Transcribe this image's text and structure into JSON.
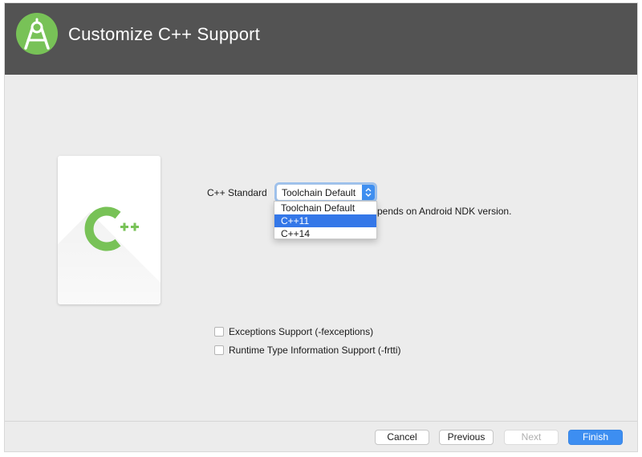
{
  "window": {
    "title": "Customize C++ Support"
  },
  "icons": {
    "logo": "android-studio-icon",
    "cpp": "cpp-logo-icon",
    "stepper": "updown-chevron-icon"
  },
  "colors": {
    "header_bg": "#535353",
    "logo_green": "#78c257",
    "selection_blue": "#3477e8",
    "primary_button": "#3d8ef1"
  },
  "form": {
    "cpp_standard_label": "C++ Standard",
    "cpp_standard_value": "Toolchain Default",
    "dropdown_options": [
      "Toolchain Default",
      "C++11",
      "C++14"
    ],
    "highlighted_option": "C++11",
    "note_partial": "pends on Android NDK version.",
    "exceptions_label": "Exceptions Support (-fexceptions)",
    "exceptions_checked": false,
    "rtti_label": "Runtime Type Information Support (-frtti)",
    "rtti_checked": false
  },
  "footer": {
    "cancel": "Cancel",
    "previous": "Previous",
    "next": "Next",
    "finish": "Finish"
  }
}
